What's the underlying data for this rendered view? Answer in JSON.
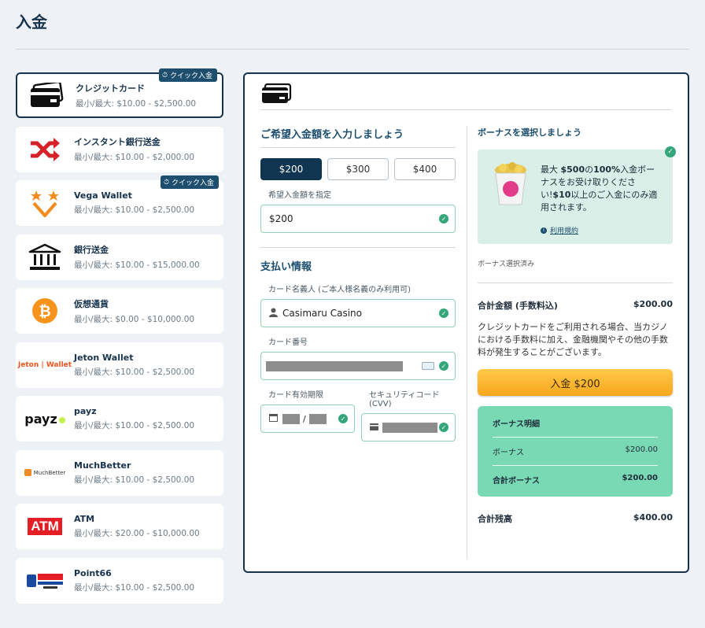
{
  "page": {
    "title": "入金"
  },
  "methods": [
    {
      "name": "クレジットカード",
      "range": "最小/最大: $10.00 - $2,500.00",
      "badge": "クイック入金",
      "icon": "credit-card-icon"
    },
    {
      "name": "インスタント銀行送金",
      "range": "最小/最大: $10.00 - $2,000.00",
      "icon": "shuffle-icon"
    },
    {
      "name": "Vega Wallet",
      "range": "最小/最大: $10.00 - $2,500.00",
      "badge": "クイック入金",
      "icon": "vega-wallet-logo"
    },
    {
      "name": "銀行送金",
      "range": "最小/最大: $10.00 - $15,000.00",
      "icon": "bank-icon"
    },
    {
      "name": "仮想通貨",
      "range": "最小/最大: $0.00 - $10,000.00",
      "icon": "bitcoin-icon"
    },
    {
      "name": "Jeton Wallet",
      "range": "最小/最大: $10.00 - $2,500.00",
      "logo_text": "Jeton | Wallet",
      "icon": "jeton-logo"
    },
    {
      "name": "payz",
      "range": "最小/最大: $10.00 - $2,500.00",
      "logo_text": "payz",
      "icon": "payz-logo"
    },
    {
      "name": "MuchBetter",
      "range": "最小/最大: $10.00 - $2,500.00",
      "logo_text": "MuchBetter",
      "icon": "muchbetter-logo"
    },
    {
      "name": "ATM",
      "range": "最小/最大: $20.00 - $10,000.00",
      "logo_text": "ATM",
      "icon": "atm-logo"
    },
    {
      "name": "Point66",
      "range": "最小/最大: $10.00 - $2,500.00",
      "icon": "point66-logo"
    }
  ],
  "deposit": {
    "amount_heading": "ご希望入金額を入力しましょう",
    "amounts": [
      "$200",
      "$300",
      "$400"
    ],
    "selected_amount": "$200",
    "custom_label": "希望入金額を指定",
    "custom_value": "$200",
    "payment_heading": "支払い情報",
    "cardholder_label": "カード名義人 (ご本人様名義のみ利用可)",
    "cardholder_value": "Casimaru Casino",
    "card_number_label": "カード番号",
    "expiry_label": "カード有効期限",
    "expiry_sep": "/",
    "cvv_label": "セキュリティコード (CVV)"
  },
  "bonus": {
    "heading": "ボーナスを選択しましょう",
    "line1_pre": "最大 ",
    "line1_amount": "$500",
    "line1_mid": "の",
    "line1_percent": "100%",
    "line1_post": "入金ボーナスをお受け取りください!",
    "line2_amount": "$10",
    "line2_post": "以上のご入金にのみ適用されます。",
    "terms": "利用規約",
    "selected_note": "ボーナス選択済み"
  },
  "summary": {
    "total_label": "合計金額 (手数料込)",
    "total_value": "$200.00",
    "fee_note": "クレジットカードをご利用される場合、当カジノにおける手数料に加え、金融機関やその他の手数料が発生することがございます。",
    "deposit_button": "入金 $200",
    "breakdown_title": "ボーナス明細",
    "bonus_label": "ボーナス",
    "bonus_value": "$200.00",
    "total_bonus_label": "合計ボーナス",
    "total_bonus_value": "$200.00",
    "balance_label": "合計残高",
    "balance_value": "$400.00"
  },
  "colors": {
    "brand_dark": "#17324d",
    "success": "#34a67a",
    "cta": "#f7a71d",
    "breakdown_bg": "#79d9b5"
  }
}
